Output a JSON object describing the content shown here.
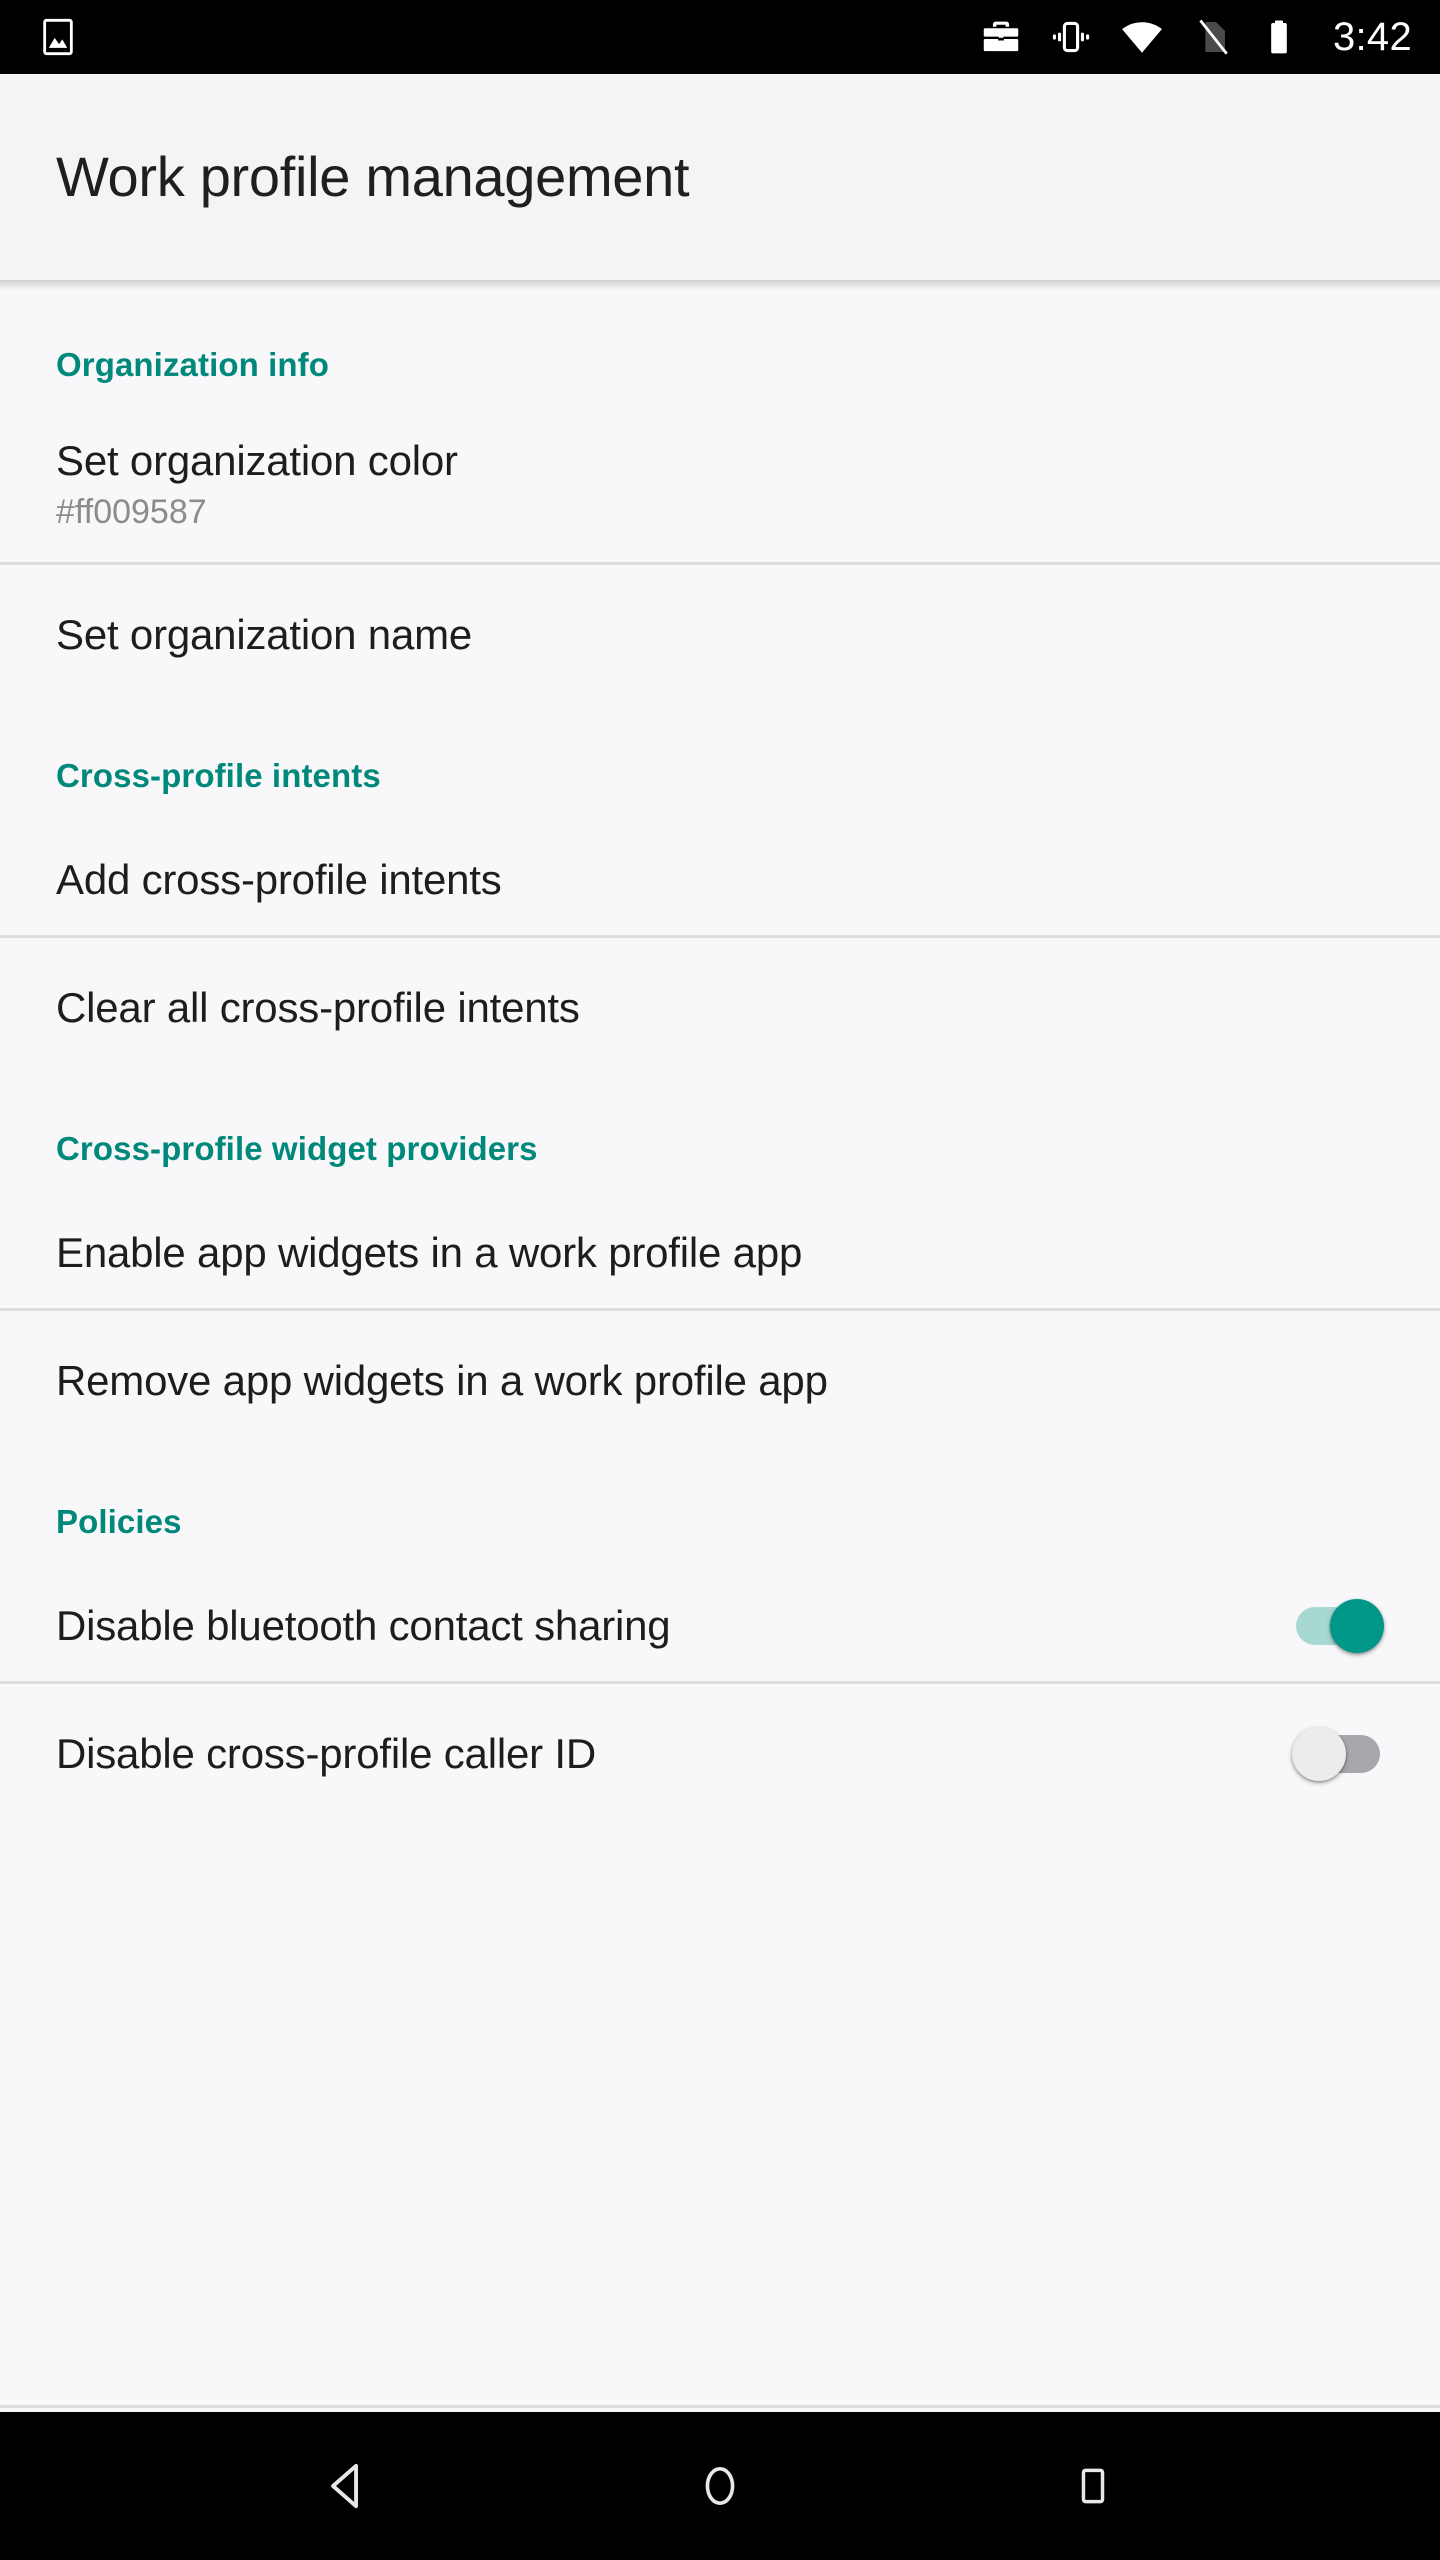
{
  "status_bar": {
    "left_icons": [
      {
        "name": "screenshot-icon",
        "label": "Screenshot"
      }
    ],
    "right_icons": [
      {
        "name": "work-profile-briefcase-icon",
        "label": "Work profile"
      },
      {
        "name": "vibrate-icon",
        "label": "Vibrate"
      },
      {
        "name": "wifi-icon",
        "label": "Wi-Fi"
      },
      {
        "name": "no-sim-icon",
        "label": "No SIM"
      },
      {
        "name": "battery-full-icon",
        "label": "Battery full"
      }
    ],
    "clock": "3:42"
  },
  "app_bar": {
    "title": "Work profile management"
  },
  "colors": {
    "accent": "#00897b",
    "switch_on_thumb": "#009688",
    "switch_on_track": "#a8d8d2",
    "switch_off_thumb": "#ececed",
    "switch_off_track": "#a8a8ac",
    "background": "#f8f7fa",
    "app_bar_background": "#f4f3f6",
    "divider": "#dcdbde",
    "title_text": "#1d1d1d",
    "summary_text": "#8c8c8c"
  },
  "sections": [
    {
      "header": "Organization info",
      "items": [
        {
          "title": "Set organization color",
          "summary": "#ff009587",
          "type": "preference"
        },
        {
          "title": "Set organization name",
          "summary": "",
          "type": "preference"
        }
      ]
    },
    {
      "header": "Cross-profile intents",
      "items": [
        {
          "title": "Add cross-profile intents",
          "summary": "",
          "type": "preference"
        },
        {
          "title": "Clear all cross-profile intents",
          "summary": "",
          "type": "preference"
        }
      ]
    },
    {
      "header": "Cross-profile widget providers",
      "items": [
        {
          "title": "Enable app widgets in a work profile app",
          "summary": "",
          "type": "preference"
        },
        {
          "title": "Remove app widgets in a work profile app",
          "summary": "",
          "type": "preference"
        }
      ]
    },
    {
      "header": "Policies",
      "items": [
        {
          "title": "Disable bluetooth contact sharing",
          "summary": "",
          "type": "switch",
          "checked": true
        },
        {
          "title": "Disable cross-profile caller ID",
          "summary": "",
          "type": "switch",
          "checked": false
        }
      ]
    }
  ],
  "nav_bar": {
    "buttons": [
      {
        "name": "back-button",
        "label": "Back"
      },
      {
        "name": "home-button",
        "label": "Home"
      },
      {
        "name": "recents-button",
        "label": "Recents"
      }
    ]
  }
}
